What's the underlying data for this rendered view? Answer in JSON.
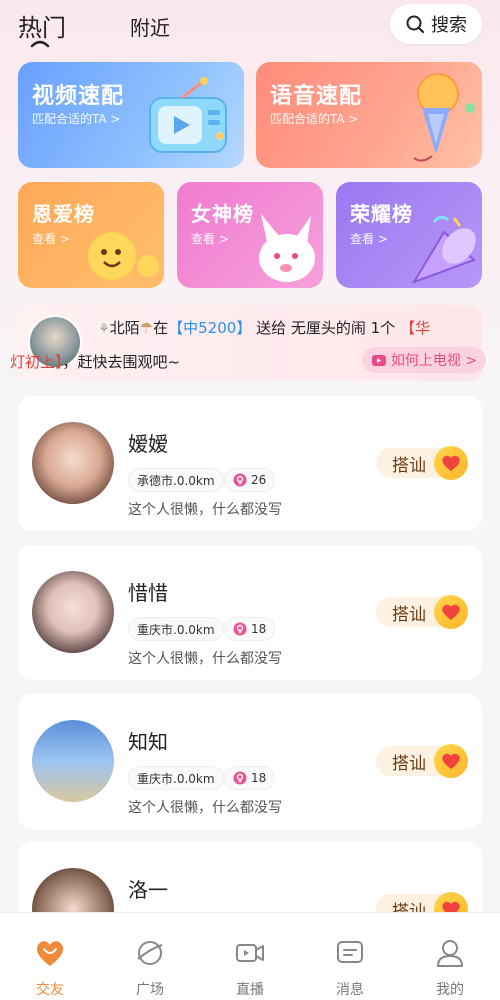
{
  "header": {
    "tabs": [
      {
        "label": "热门",
        "active": true
      },
      {
        "label": "附近",
        "active": false
      }
    ],
    "search_label": "搜索"
  },
  "feature_cards": [
    {
      "title": "视频速配",
      "subtitle": "匹配合适的TA >",
      "icon": "tv-icon",
      "color": "#6aa0ff"
    },
    {
      "title": "语音速配",
      "subtitle": "匹配合适的TA >",
      "icon": "microphone-icon",
      "color": "#ff8c7a"
    }
  ],
  "rank_cards": [
    {
      "title": "恩爱榜",
      "subtitle": "查看 >",
      "icon": "smiley-icon",
      "color": "#ffa95a"
    },
    {
      "title": "女神榜",
      "subtitle": "查看 >",
      "icon": "bunny-icon",
      "color": "#f07bd0"
    },
    {
      "title": "荣耀榜",
      "subtitle": "查看 >",
      "icon": "horn-icon",
      "color": "#9a78f0"
    }
  ],
  "banner": {
    "sender": "北陌",
    "in_text": "在",
    "room": "【中5200】",
    "gift_text": "送给 无厘头的闹 1个",
    "gift_name_part1": "【华",
    "gift_name_part2": "灯初上】",
    "tail": "，赶快去围观吧~",
    "tv_button": "如何上电视 >"
  },
  "users": [
    {
      "name": "嫒嫒",
      "city": "承德市.0.0km",
      "age": "26",
      "bio": "这个人很懒，什么都没写",
      "action": "搭讪"
    },
    {
      "name": "惜惜",
      "city": "重庆市.0.0km",
      "age": "18",
      "bio": "这个人很懒，什么都没写",
      "action": "搭讪"
    },
    {
      "name": "知知",
      "city": "重庆市.0.0km",
      "age": "18",
      "bio": "这个人很懒，什么都没写",
      "action": "搭讪"
    },
    {
      "name": "洛一",
      "city": "",
      "age": "",
      "bio": "",
      "action": "搭讪"
    }
  ],
  "bottom_nav": [
    {
      "label": "交友",
      "icon": "heart-icon",
      "active": true
    },
    {
      "label": "广场",
      "icon": "planet-icon",
      "active": false
    },
    {
      "label": "直播",
      "icon": "video-camera-icon",
      "active": false
    },
    {
      "label": "消息",
      "icon": "message-icon",
      "active": false
    },
    {
      "label": "我的",
      "icon": "profile-icon",
      "active": false
    }
  ],
  "colors": {
    "accent": "#ef8a3a",
    "badge_pink": "#e84a86",
    "highlight_red": "#e8413a",
    "highlight_blue": "#2b8ff0"
  }
}
